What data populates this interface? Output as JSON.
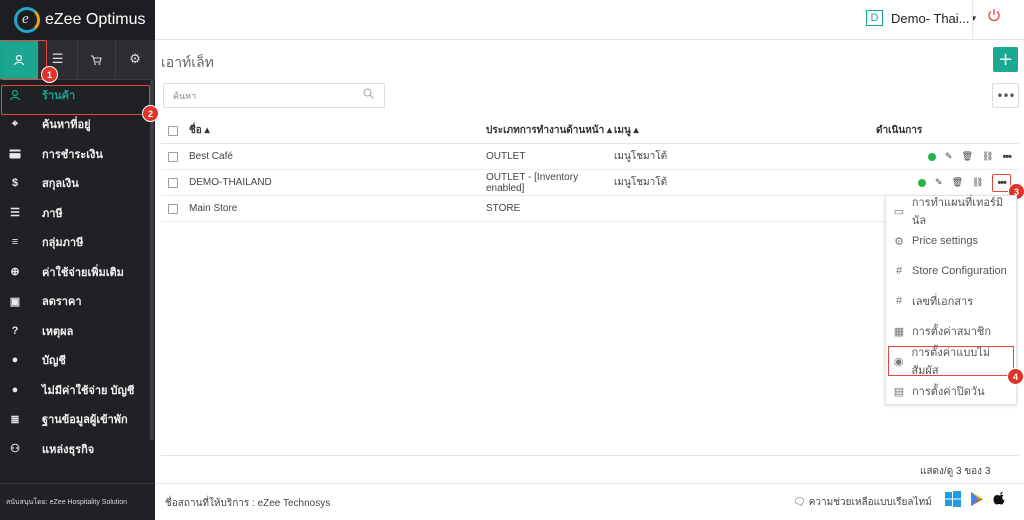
{
  "app": {
    "name": "eZee Optimus",
    "logo_letter": "e"
  },
  "header": {
    "property_badge": "D",
    "property_name": "Demo- Thai...",
    "caret": "▾"
  },
  "sidebar": {
    "tabs": [
      "user",
      "menu",
      "cart",
      "gear"
    ],
    "items": [
      {
        "label": "ร้านค้า",
        "icon": "user-icon"
      },
      {
        "label": "ค้นหาที่อยู่",
        "icon": "location-icon"
      },
      {
        "label": "การชำระเงิน",
        "icon": "card-icon"
      },
      {
        "label": "สกุลเงิน",
        "icon": "dollar-icon"
      },
      {
        "label": "ภาษี",
        "icon": "list-icon"
      },
      {
        "label": "กลุ่มภาษี",
        "icon": "list-bullet-icon"
      },
      {
        "label": "ค่าใช้จ่ายเพิ่มเติม",
        "icon": "plus-circle-icon"
      },
      {
        "label": "ลดราคา",
        "icon": "gift-icon"
      },
      {
        "label": "เหตุผล",
        "icon": "question-icon"
      },
      {
        "label": "บัญชี",
        "icon": "person-icon"
      },
      {
        "label": "ไม่มีค่าใช้จ่าย บัญชี",
        "icon": "person-icon"
      },
      {
        "label": "ฐานข้อมูลผู้เข้าพัก",
        "icon": "database-icon"
      },
      {
        "label": "แหล่งธุรกิจ",
        "icon": "group-icon"
      }
    ],
    "footer": "สนับสนุนโดย: eZee Hospitality Solution"
  },
  "main": {
    "title": "เอาท์เล็ท",
    "search_placeholder": "ค้นหา",
    "columns": {
      "name": "ชื่อ ▴",
      "type": "ประเภทการทำงานด้านหน้า ▴",
      "menu": "เมนู ▴",
      "actions": "ดำเนินการ"
    },
    "rows": [
      {
        "name": "Best Café",
        "type": "OUTLET",
        "menu": "เมนูโชมาโต้",
        "has_actions": true
      },
      {
        "name": "DEMO-THAILAND",
        "type": "OUTLET - [Inventory enabled]",
        "menu": "เมนูโชมาโต้",
        "has_actions": true
      },
      {
        "name": "Main Store",
        "type": "STORE",
        "menu": "",
        "has_actions": false
      }
    ],
    "records_text": "แสดง/ดู 3 ของ 3"
  },
  "dropdown": {
    "items": [
      {
        "label": "การทำแผนที่เทอร์มินัล",
        "icon": "monitor-icon"
      },
      {
        "label": "Price settings",
        "icon": "gear-icon"
      },
      {
        "label": "Store Configuration",
        "icon": "hash-icon"
      },
      {
        "label": "เลขที่เอกสาร",
        "icon": "hash-icon"
      },
      {
        "label": "การตั้งค่าสมาชิก",
        "icon": "member-icon"
      },
      {
        "label": "การตั้งค่าแบบไม่สัมผัส",
        "icon": "eye-icon"
      },
      {
        "label": "การตั้งค่าปิดวัน",
        "icon": "calendar-icon"
      }
    ]
  },
  "callouts": [
    "1",
    "2",
    "3",
    "4"
  ],
  "footer": {
    "service_name": "ชื่อสถานที่ให้บริการ : eZee Technosys",
    "help": "ความช่วยเหลือแบบเรียลไทม์"
  },
  "colors": {
    "accent": "#1aa68f",
    "callout": "#e0332a",
    "sidebar_bg": "#1f2124",
    "status_green": "#2bb14a"
  }
}
